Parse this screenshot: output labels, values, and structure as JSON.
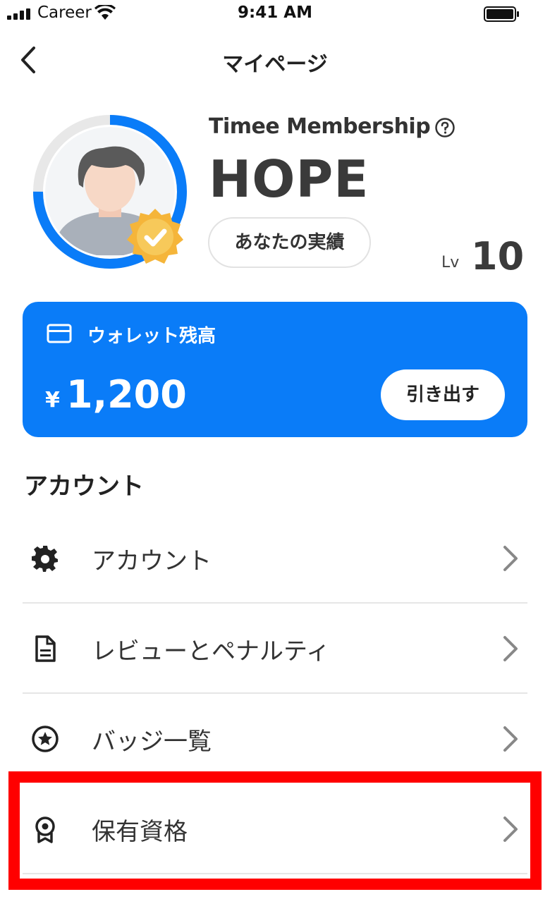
{
  "status_bar": {
    "carrier": "Career",
    "time": "9:41 AM"
  },
  "nav": {
    "title": "マイページ"
  },
  "profile": {
    "membership_label": "Timee Membership",
    "rank": "HOPE",
    "achievements_button": "あなたの実績",
    "level_label": "Lv",
    "level_value": "10",
    "level_progress": 0.75
  },
  "wallet": {
    "title": "ウォレット残高",
    "currency_symbol": "¥",
    "balance": "1,200",
    "withdraw_button": "引き出す"
  },
  "account_section": {
    "heading": "アカウント",
    "items": [
      {
        "label": "アカウント",
        "icon": "gear-icon"
      },
      {
        "label": "レビューとペナルティ",
        "icon": "document-icon"
      },
      {
        "label": "バッジ一覧",
        "icon": "star-circle-icon"
      },
      {
        "label": "保有資格",
        "icon": "award-icon"
      }
    ]
  },
  "colors": {
    "accent": "#0a7cf8",
    "highlight": "#ff0000",
    "badge_gold": "#f5b53a"
  }
}
